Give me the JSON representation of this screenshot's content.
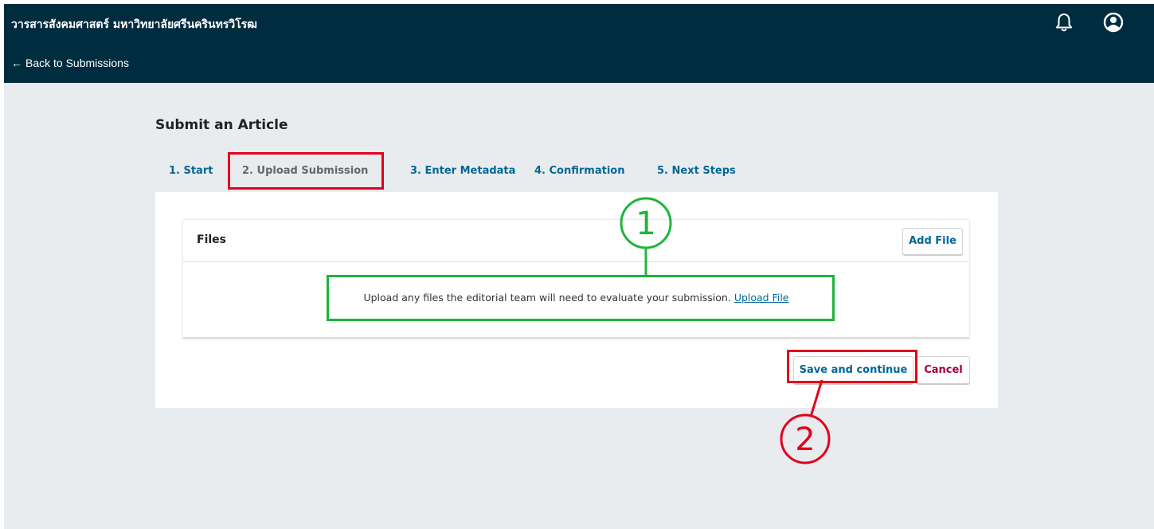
{
  "header": {
    "site_title": "วารสารสังคมศาสตร์ มหาวิทยาลัยศรีนครินทรวิโรฒ",
    "back_link": "Back to Submissions",
    "icons": [
      "bell-icon",
      "user-circle-icon"
    ],
    "background": "#002c40"
  },
  "page": {
    "title": "Submit an Article"
  },
  "tabs": [
    {
      "label": "1. Start"
    },
    {
      "label": "2. Upload Submission",
      "active": true
    },
    {
      "label": "3. Enter Metadata"
    },
    {
      "label": "4. Confirmation"
    },
    {
      "label": "5. Next Steps"
    }
  ],
  "files": {
    "title": "Files",
    "add_file": "Add File",
    "message": "Upload any files the editorial team will need to evaluate your submission.",
    "upload_link": "Upload File"
  },
  "actions": {
    "save": "Save and continue",
    "cancel": "Cancel"
  },
  "annotations": {
    "marker1": "1",
    "marker2": "2"
  },
  "colors": {
    "link": "#006798",
    "cancel": "#a10040",
    "highlight_red": "#e3001b",
    "highlight_green": "#1db53b",
    "page_bg": "#e9ecee"
  }
}
